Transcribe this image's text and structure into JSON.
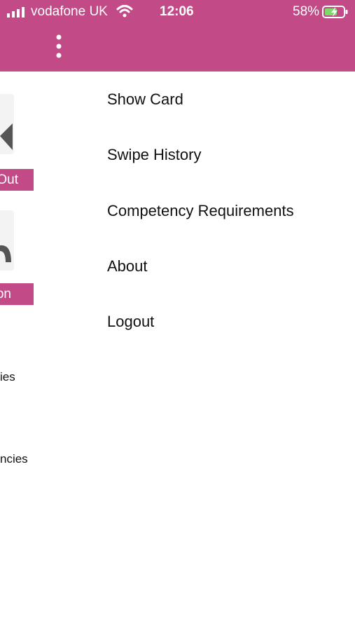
{
  "status_bar": {
    "carrier": "vodafone UK",
    "time": "12:06",
    "battery_percent": "58%",
    "icons": [
      "signal-icon",
      "wifi-icon",
      "battery-charging-icon"
    ]
  },
  "appbar": {
    "color": "#c24a86",
    "overflow_icon": "more-vertical-icon"
  },
  "background_content": {
    "button1_label": "Out",
    "button2_label": "on",
    "text1": "ies",
    "text2": "ncies"
  },
  "drawer": {
    "items": [
      {
        "label": "Show Card"
      },
      {
        "label": "Swipe History"
      },
      {
        "label": "Competency Requirements"
      },
      {
        "label": "About"
      },
      {
        "label": "Logout"
      }
    ]
  }
}
